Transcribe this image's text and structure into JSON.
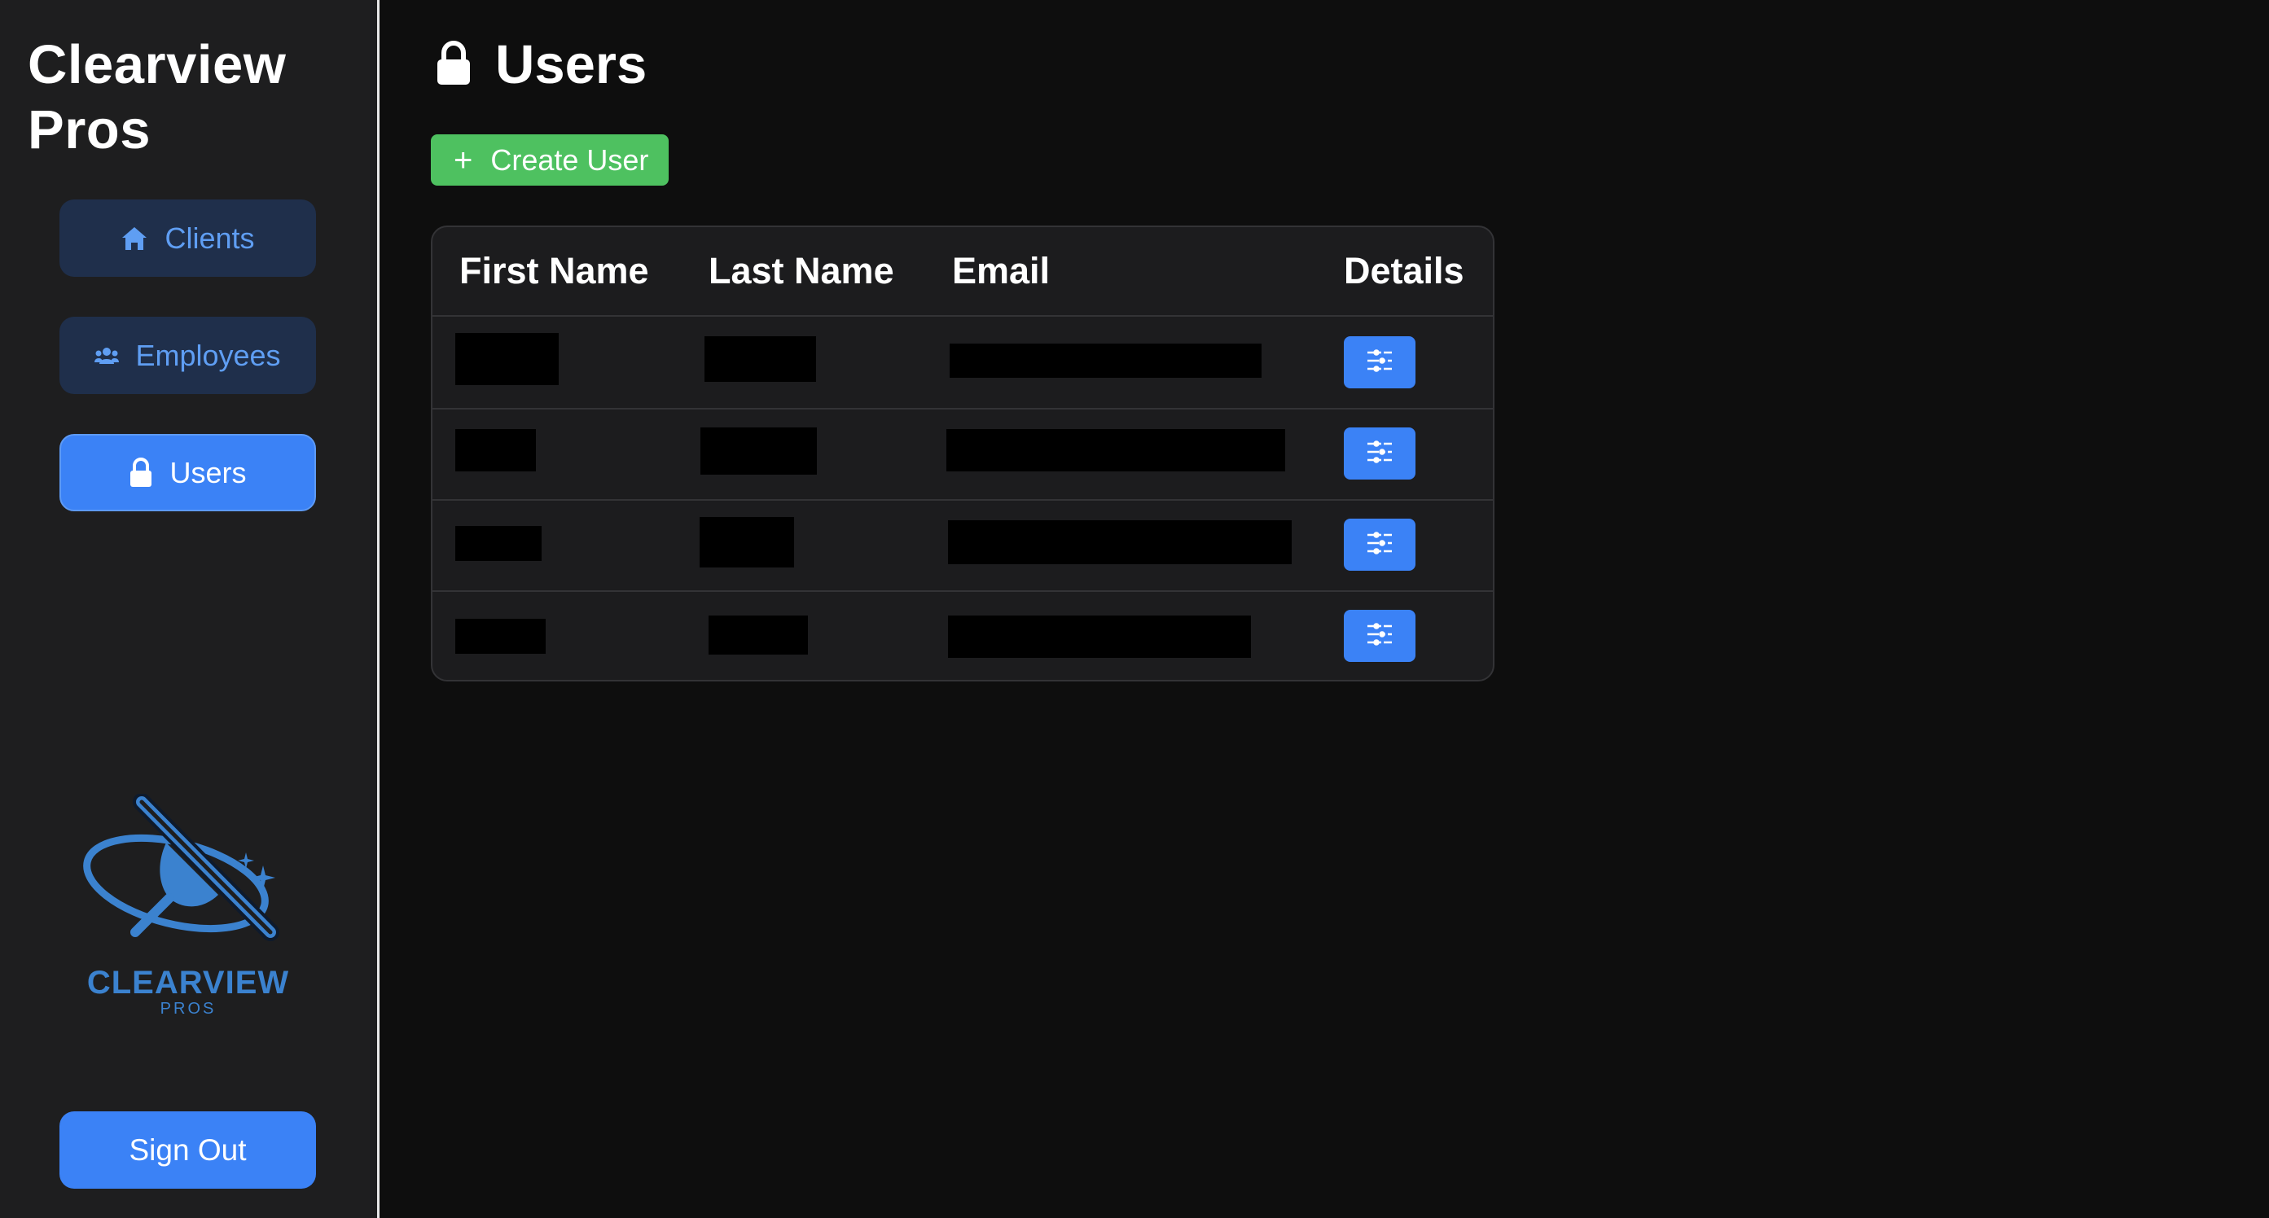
{
  "sidebar": {
    "brand": "Clearview Pros",
    "nav": [
      {
        "label": "Clients",
        "icon": "home-icon",
        "active": false
      },
      {
        "label": "Employees",
        "icon": "users-group-icon",
        "active": false
      },
      {
        "label": "Users",
        "icon": "lock-icon",
        "active": true
      }
    ],
    "logo": {
      "word": "CLEARVIEW",
      "sub": "PROS"
    },
    "sign_out": "Sign Out"
  },
  "main": {
    "title": "Users",
    "title_icon": "lock-icon",
    "create_button": "Create User",
    "table": {
      "columns": [
        "First Name",
        "Last Name",
        "Email",
        "Details"
      ],
      "rows": [
        {
          "first_name": "[redacted]",
          "last_name": "[redacted]",
          "email": "[redacted]"
        },
        {
          "first_name": "[redacted]",
          "last_name": "[redacted]",
          "email": "[redacted]"
        },
        {
          "first_name": "[redacted]",
          "last_name": "[redacted]",
          "email": "[redacted]"
        },
        {
          "first_name": "[redacted]",
          "last_name": "[redacted]",
          "email": "[redacted]"
        }
      ]
    }
  },
  "colors": {
    "accent": "#3b82f6",
    "success": "#4ec160",
    "sidebar_bg": "#1e1e1f",
    "page_bg": "#0e0e0e"
  }
}
